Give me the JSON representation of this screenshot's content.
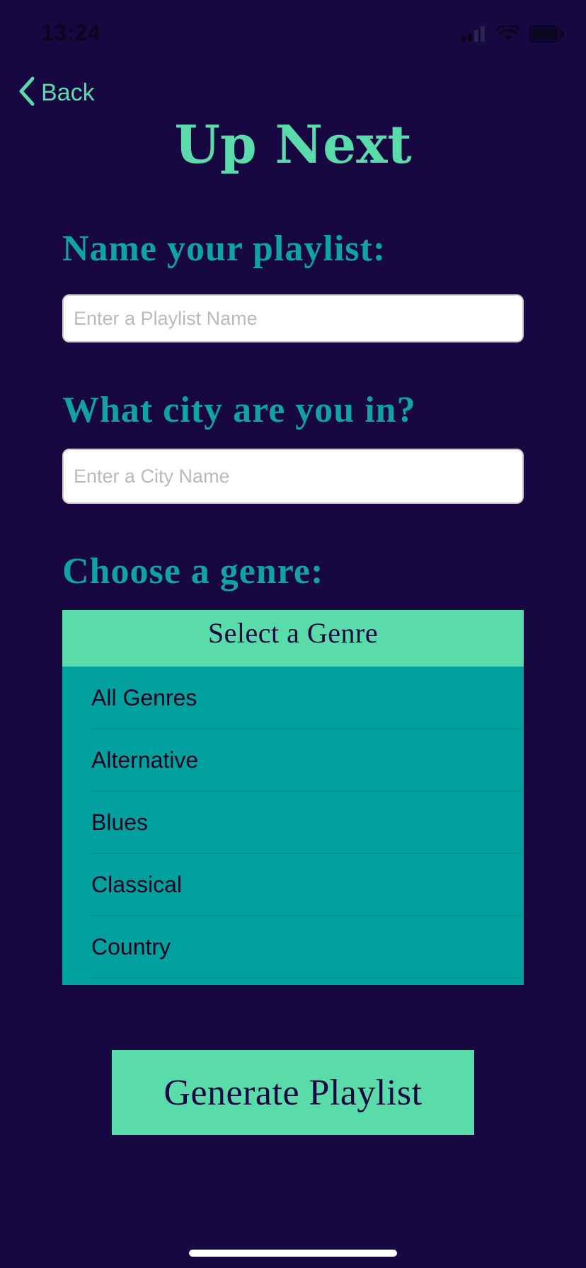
{
  "status_bar": {
    "time": "13:24"
  },
  "nav": {
    "back_label": "Back"
  },
  "app_title": "Up Next",
  "playlist_section": {
    "label": "Name your playlist:",
    "placeholder": "Enter a Playlist Name",
    "value": ""
  },
  "city_section": {
    "label": "What city are you in?",
    "placeholder": "Enter a City Name",
    "value": ""
  },
  "genre_section": {
    "label": "Choose a genre:",
    "header": "Select a Genre",
    "items": [
      {
        "label": "All Genres"
      },
      {
        "label": "Alternative"
      },
      {
        "label": "Blues"
      },
      {
        "label": "Classical"
      },
      {
        "label": "Country"
      }
    ]
  },
  "actions": {
    "generate_label": "Generate Playlist"
  },
  "colors": {
    "background": "#180842",
    "accent_green": "#5adcaa",
    "teal_label": "#10a3a3",
    "list_teal": "#00a19f"
  },
  "icons": {
    "back": "chevron-left-icon",
    "signal": "cellular-signal-icon",
    "wifi": "wifi-icon",
    "battery": "battery-icon"
  }
}
